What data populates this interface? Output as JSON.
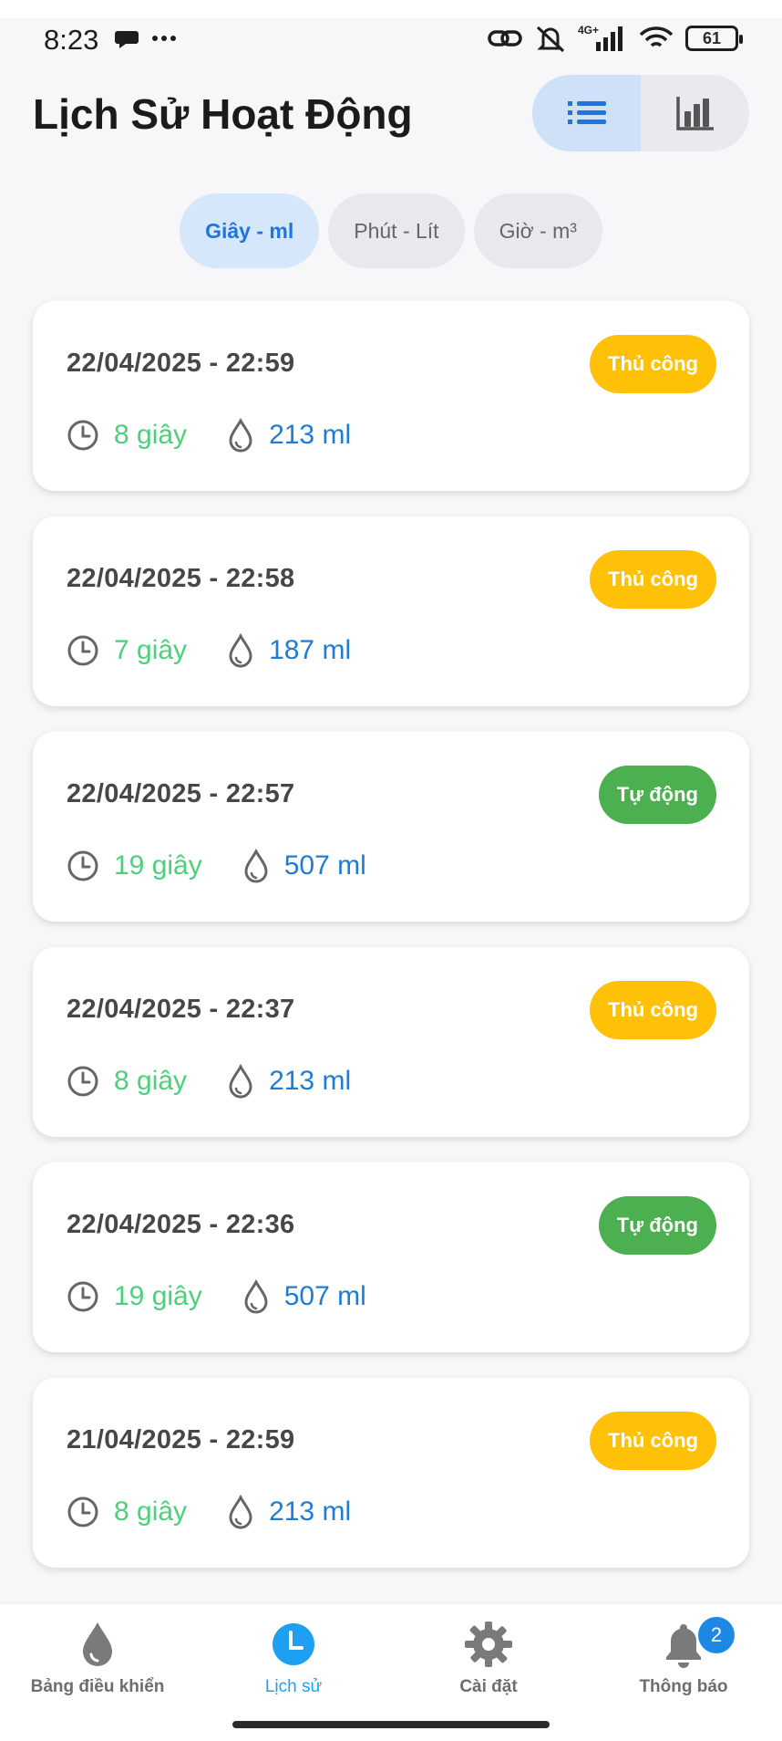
{
  "status_bar": {
    "time": "8:23",
    "network": "4G+",
    "battery": "61",
    "icons": [
      "chat-bubble-icon",
      "more-dots-icon",
      "link-icon",
      "bell-off-icon",
      "signal-icon",
      "wifi-icon",
      "battery-icon"
    ]
  },
  "header": {
    "title": "Lịch Sử Hoạt Động",
    "view_toggle": [
      {
        "icon": "list-icon",
        "active": true
      },
      {
        "icon": "bar-chart-icon",
        "active": false
      }
    ]
  },
  "unit_tabs": [
    {
      "label": "Giây - ml",
      "active": true
    },
    {
      "label": "Phút - Lít",
      "active": false
    },
    {
      "label": "Giờ - m³",
      "active": false
    }
  ],
  "records": [
    {
      "datetime": "22/04/2025 - 22:59",
      "mode": "Thủ công",
      "type": "manual",
      "duration": "8 giây",
      "volume": "213 ml"
    },
    {
      "datetime": "22/04/2025 - 22:58",
      "mode": "Thủ công",
      "type": "manual",
      "duration": "7 giây",
      "volume": "187 ml"
    },
    {
      "datetime": "22/04/2025 - 22:57",
      "mode": "Tự động",
      "type": "auto",
      "duration": "19 giây",
      "volume": "507 ml"
    },
    {
      "datetime": "22/04/2025 - 22:37",
      "mode": "Thủ công",
      "type": "manual",
      "duration": "8 giây",
      "volume": "213 ml"
    },
    {
      "datetime": "22/04/2025 - 22:36",
      "mode": "Tự động",
      "type": "auto",
      "duration": "19 giây",
      "volume": "507 ml"
    },
    {
      "datetime": "21/04/2025 - 22:59",
      "mode": "Thủ công",
      "type": "manual",
      "duration": "8 giây",
      "volume": "213 ml"
    }
  ],
  "bottom_nav": {
    "items": [
      {
        "label": "Bảng điều khiển",
        "icon": "water-drop-icon",
        "active": false
      },
      {
        "label": "Lịch sử",
        "icon": "clock-icon",
        "active": true
      },
      {
        "label": "Cài đặt",
        "icon": "gear-icon",
        "active": false
      },
      {
        "label": "Thông báo",
        "icon": "bell-icon",
        "active": false
      }
    ],
    "notification_count": "2"
  },
  "colors": {
    "accent": "#1f75e0",
    "manual": "#ffc107",
    "auto": "#4caf50",
    "duration": "#4cd07a",
    "volume": "#1e7bd6",
    "nav_active": "#1ea0f2"
  }
}
